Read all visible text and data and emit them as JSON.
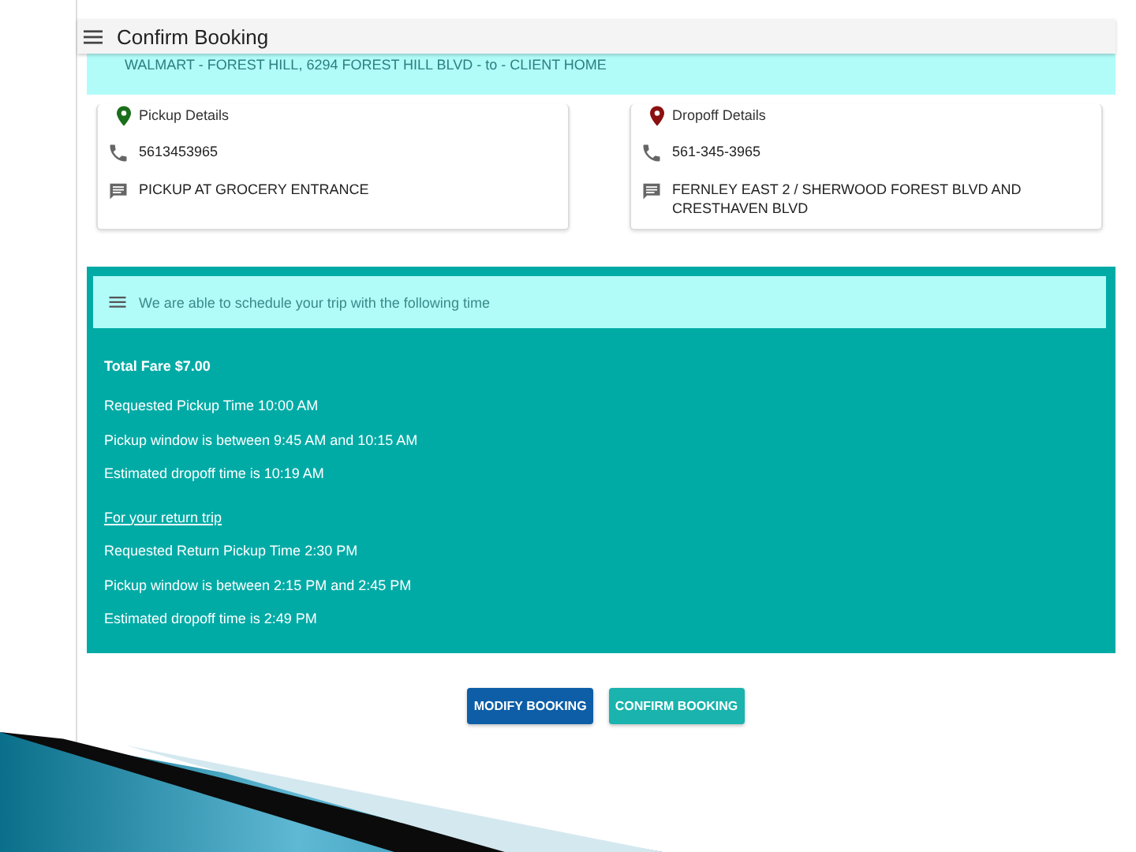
{
  "header": {
    "title": "Confirm Booking"
  },
  "route": {
    "text": "WALMART - FOREST HILL, 6294 FOREST HILL BLVD - to - CLIENT HOME"
  },
  "cards": [
    {
      "kind": "pickup",
      "title": "Pickup Details",
      "phone": "5613453965",
      "note": "PICKUP AT GROCERY ENTRANCE"
    },
    {
      "kind": "dropoff",
      "title": "Dropoff Details",
      "phone": "561-345-3965",
      "note": "FERNLEY EAST 2 / SHERWOOD FOREST BLVD AND CRESTHAVEN BLVD"
    }
  ],
  "schedule": {
    "banner": "We are able to schedule your trip with the following time",
    "lines": [
      {
        "kind": "fare",
        "text": "Total Fare $7.00"
      },
      {
        "kind": "line",
        "text": "Requested Pickup Time 10:00 AM"
      },
      {
        "kind": "line",
        "text": "Pickup window is between 9:45 AM and 10:15 AM"
      },
      {
        "kind": "line",
        "text": "Estimated dropoff time is 10:19 AM"
      },
      {
        "kind": "heading",
        "text": "For your return trip"
      },
      {
        "kind": "line",
        "text": "Requested Return Pickup Time 2:30 PM"
      },
      {
        "kind": "line",
        "text": "Pickup window is between 2:15 PM and 2:45 PM"
      },
      {
        "kind": "line",
        "text": "Estimated dropoff time is 2:49 PM"
      }
    ]
  },
  "buttons": [
    {
      "kind": "secondary",
      "label": "MODIFY BOOKING"
    },
    {
      "kind": "primary",
      "label": "CONFIRM BOOKING"
    }
  ]
}
